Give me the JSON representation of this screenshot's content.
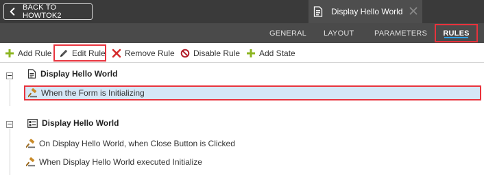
{
  "header": {
    "back_label": "BACK TO HOWTOK2",
    "form_tab_title": "Display Hello World"
  },
  "tabs": [
    {
      "label": "GENERAL"
    },
    {
      "label": "LAYOUT"
    },
    {
      "label": "PARAMETERS"
    },
    {
      "label": "RULES",
      "active": true
    }
  ],
  "toolbar": {
    "add_rule": "Add Rule",
    "edit_rule": "Edit Rule",
    "remove_rule": "Remove Rule",
    "disable_rule": "Disable Rule",
    "add_state": "Add State"
  },
  "tree": {
    "groups": [
      {
        "title": "Display Hello World",
        "icon": "form-icon",
        "rules": [
          {
            "label": "When the Form is Initializing",
            "selected": true
          }
        ]
      },
      {
        "title": "Display Hello World",
        "icon": "view-icon",
        "rules": [
          {
            "label": "On Display Hello World, when Close Button is Clicked"
          },
          {
            "label": "When Display Hello World executed Initialize"
          }
        ]
      }
    ]
  },
  "colors": {
    "topbar": "#3a3a3a",
    "tabrow": "#4a4a4a",
    "highlight": "#e8323c",
    "active_underline": "#2ea0e4",
    "selected_row": "#d5e7f6",
    "add_green": "#8cb521",
    "remove_red": "#d42b2b"
  }
}
